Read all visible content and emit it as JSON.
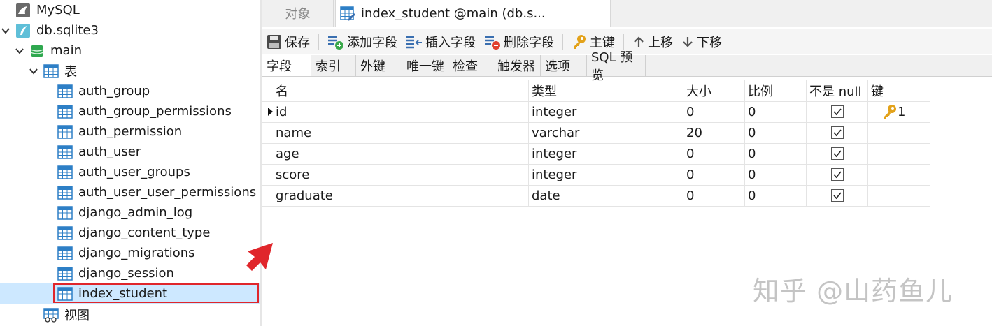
{
  "tree": {
    "mysql": "MySQL",
    "db": "db.sqlite3",
    "schema": "main",
    "tables_folder": "表",
    "tables": [
      "auth_group",
      "auth_group_permissions",
      "auth_permission",
      "auth_user",
      "auth_user_groups",
      "auth_user_user_permissions",
      "django_admin_log",
      "django_content_type",
      "django_migrations",
      "django_session",
      "index_student"
    ],
    "selected_table": "index_student",
    "views_folder": "视图"
  },
  "tabs": {
    "objects": "对象",
    "active": "index_student @main (db.s..."
  },
  "toolbar": {
    "save": "保存",
    "add_field": "添加字段",
    "insert_field": "插入字段",
    "delete_field": "删除字段",
    "primary_key": "主键",
    "move_up": "上移",
    "move_down": "下移"
  },
  "subtabs": [
    "字段",
    "索引",
    "外键",
    "唯一键",
    "检查",
    "触发器",
    "选项",
    "SQL 预览"
  ],
  "grid": {
    "headers": [
      "名",
      "类型",
      "大小",
      "比例",
      "不是 null",
      "键"
    ],
    "rows": [
      {
        "name": "id",
        "type": "integer",
        "size": "0",
        "scale": "0",
        "not_null": true,
        "key": "1"
      },
      {
        "name": "name",
        "type": "varchar",
        "size": "20",
        "scale": "0",
        "not_null": true,
        "key": ""
      },
      {
        "name": "age",
        "type": "integer",
        "size": "0",
        "scale": "0",
        "not_null": true,
        "key": ""
      },
      {
        "name": "score",
        "type": "integer",
        "size": "0",
        "scale": "0",
        "not_null": true,
        "key": ""
      },
      {
        "name": "graduate",
        "type": "date",
        "size": "0",
        "scale": "0",
        "not_null": true,
        "key": ""
      }
    ]
  },
  "watermark": "知乎 @山药鱼儿",
  "colors": {
    "selection": "#cde8ff",
    "highlight_border": "#e0262b",
    "arrow": "#e0262b",
    "key_icon": "#e3a21a"
  }
}
